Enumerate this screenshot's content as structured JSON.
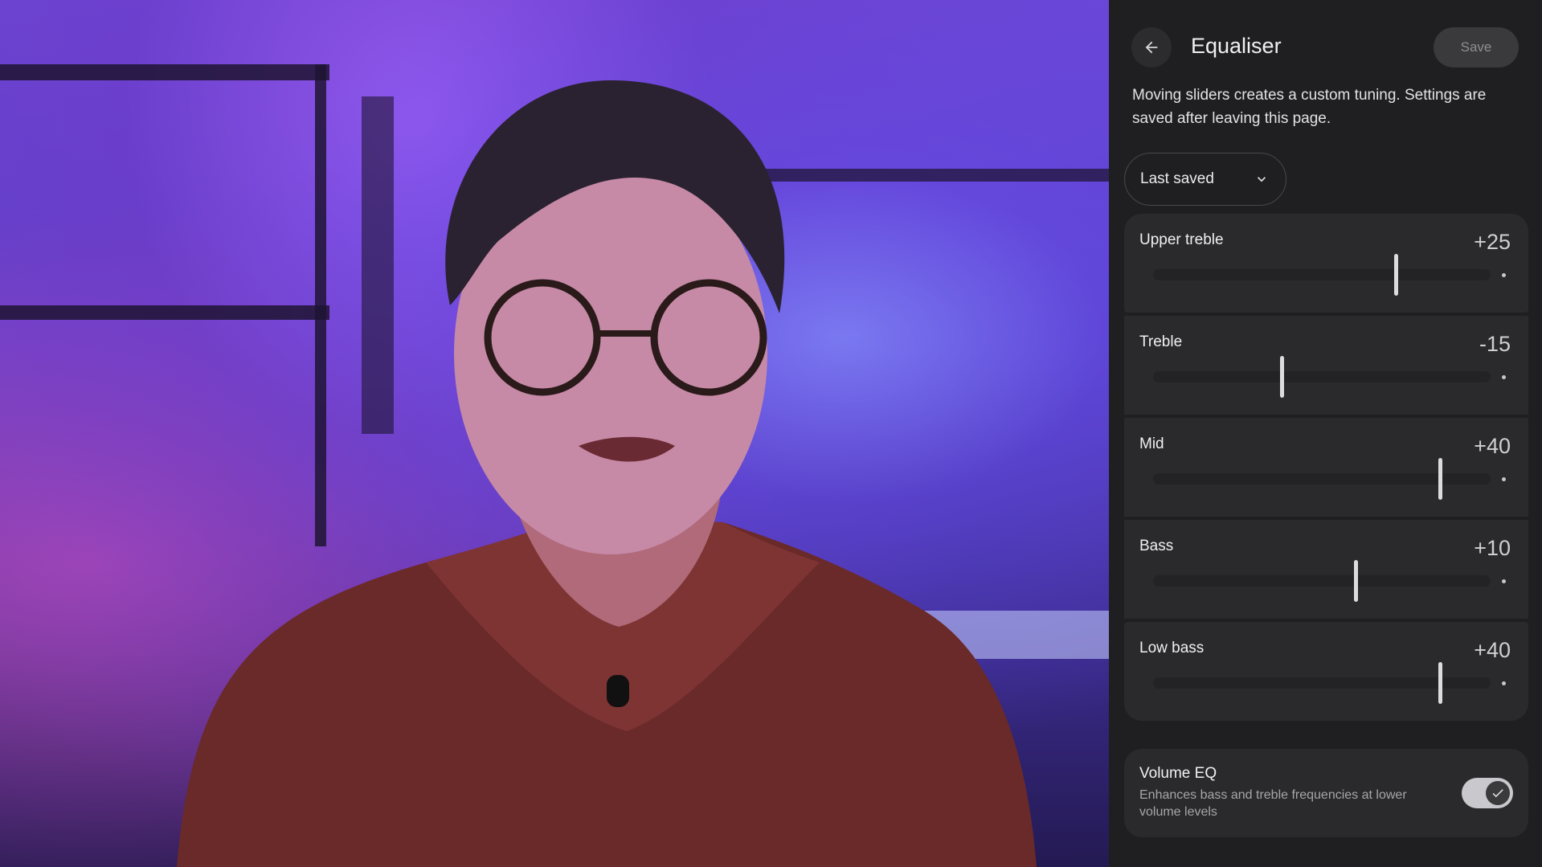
{
  "header": {
    "title": "Equaliser",
    "save_label": "Save",
    "back_icon": "arrow-left-icon"
  },
  "description": "Moving sliders creates a custom tuning. Settings are saved after leaving this page.",
  "preset": {
    "selected": "Last saved",
    "icon": "chevron-down-icon"
  },
  "bands": [
    {
      "label": "Upper treble",
      "value": "+25",
      "level": 0.72
    },
    {
      "label": "Treble",
      "value": "-15",
      "level": 0.38
    },
    {
      "label": "Mid",
      "value": "+40",
      "level": 0.85
    },
    {
      "label": "Bass",
      "value": "+10",
      "level": 0.6
    },
    {
      "label": "Low bass",
      "value": "+40",
      "level": 0.85
    }
  ],
  "volume_eq": {
    "title": "Volume EQ",
    "description": "Enhances bass and treble frequencies at lower volume levels",
    "enabled": true,
    "icon": "check-icon"
  },
  "colors": {
    "panel_bg": "#1f1f21",
    "card_bg": "#2a2a2d",
    "accent": "#c9c9cd"
  }
}
